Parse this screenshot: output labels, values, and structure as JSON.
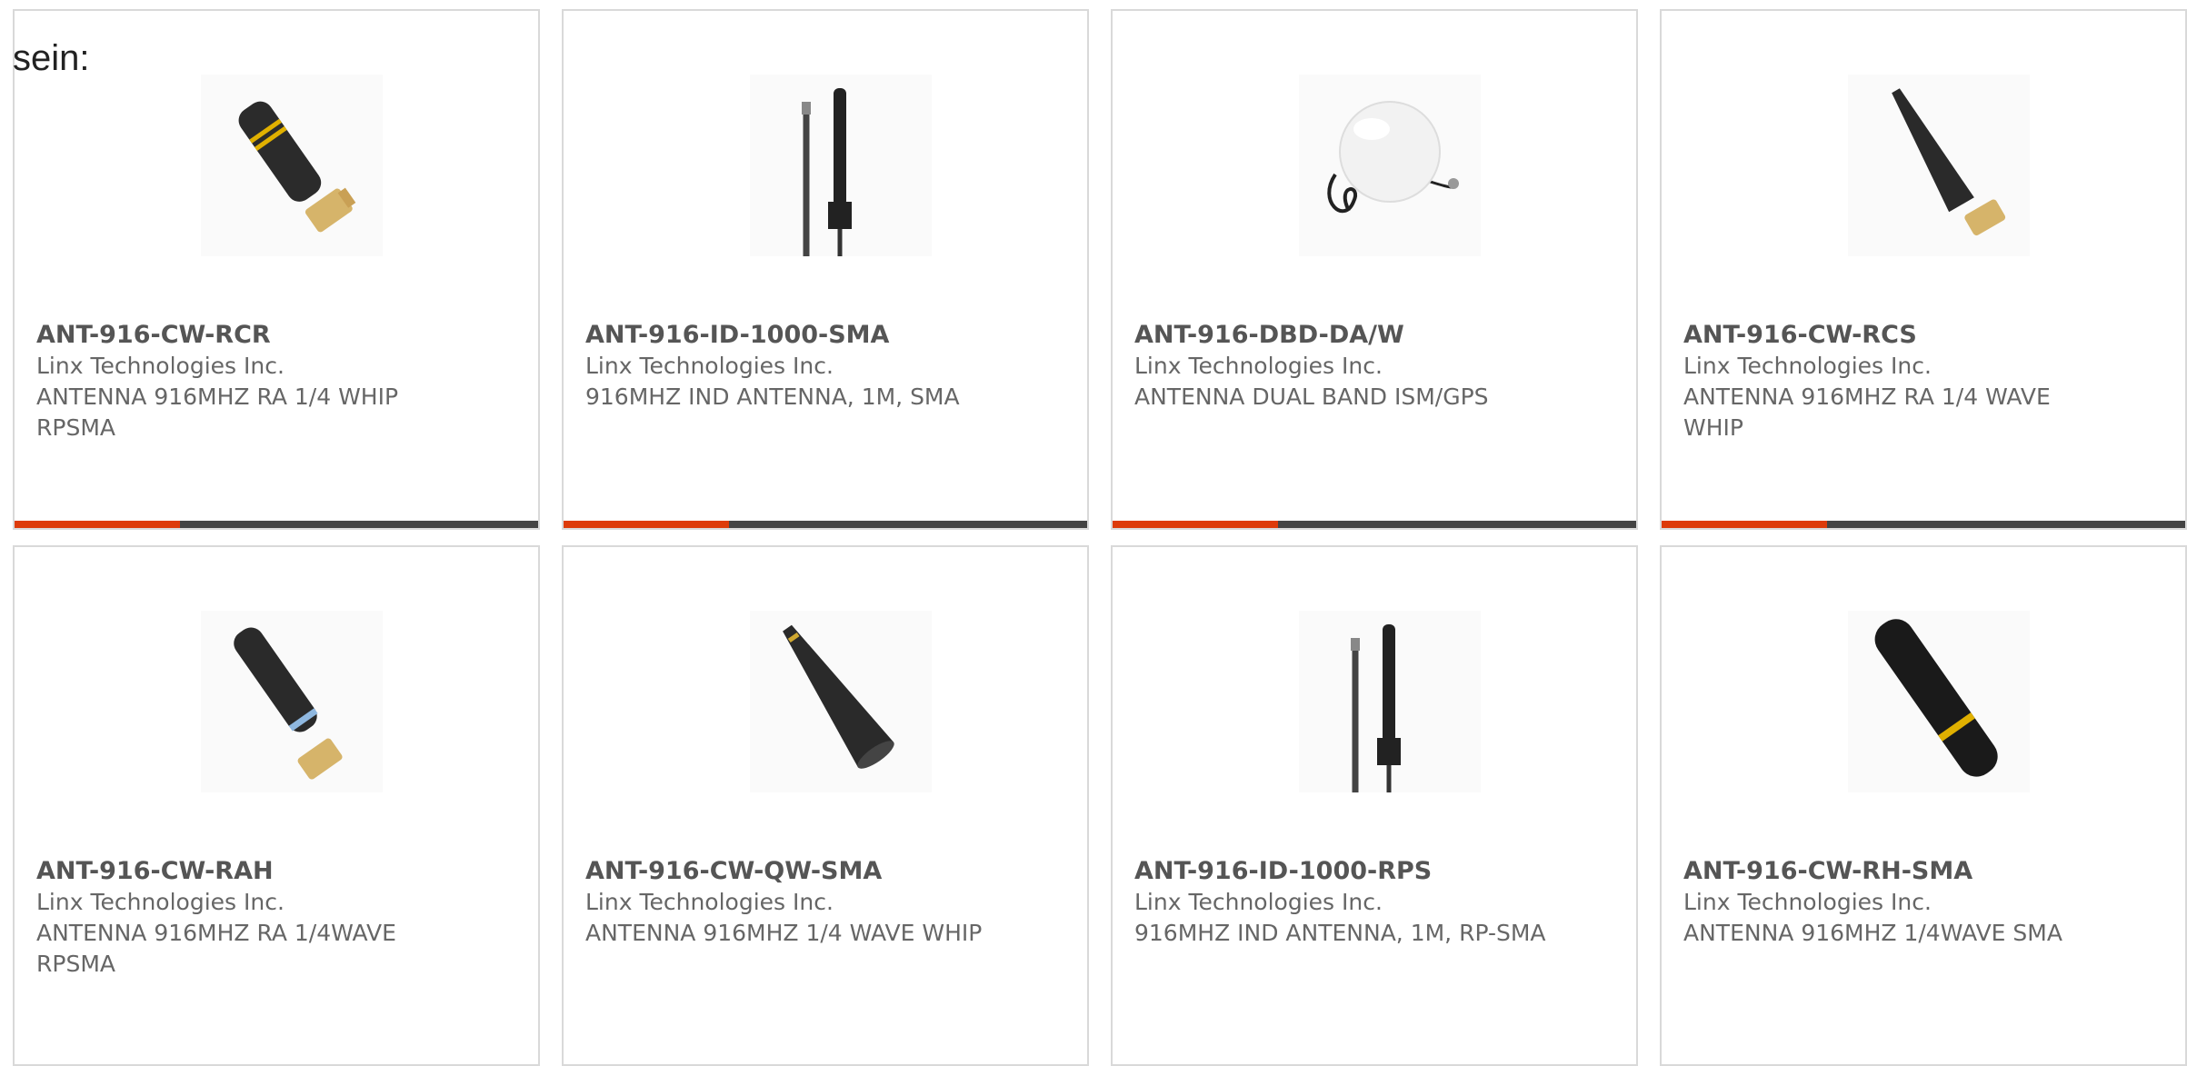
{
  "intro_text": "sein:",
  "colors": {
    "accent": "#dd3b0a",
    "bar": "#444444",
    "border": "#d9d9d9"
  },
  "products": [
    {
      "part_number": "ANT-916-CW-RCR",
      "manufacturer": "Linx Technologies Inc.",
      "description": "ANTENNA 916MHZ RA 1/4 WHIP RPSMA",
      "icon": "stubby-antenna-right-angle-image"
    },
    {
      "part_number": "ANT-916-ID-1000-SMA",
      "manufacturer": "Linx Technologies Inc.",
      "description": "916MHZ IND ANTENNA, 1M, SMA",
      "icon": "mast-antenna-with-cable-image"
    },
    {
      "part_number": "ANT-916-DBD-DA/W",
      "manufacturer": "Linx Technologies Inc.",
      "description": "ANTENNA DUAL BAND ISM/GPS",
      "icon": "dome-antenna-image"
    },
    {
      "part_number": "ANT-916-CW-RCS",
      "manufacturer": "Linx Technologies Inc.",
      "description": "ANTENNA 916MHZ RA 1/4 WAVE WHIP",
      "icon": "whip-antenna-right-angle-image"
    },
    {
      "part_number": "ANT-916-CW-RAH",
      "manufacturer": "Linx Technologies Inc.",
      "description": "ANTENNA 916MHZ RA 1/4WAVE RPSMA",
      "icon": "stubby-antenna-blue-band-image"
    },
    {
      "part_number": "ANT-916-CW-QW-SMA",
      "manufacturer": "Linx Technologies Inc.",
      "description": "ANTENNA 916MHZ 1/4 WAVE WHIP",
      "icon": "tapered-antenna-image"
    },
    {
      "part_number": "ANT-916-ID-1000-RPS",
      "manufacturer": "Linx Technologies Inc.",
      "description": "916MHZ IND ANTENNA, 1M, RP-SMA",
      "icon": "mast-antenna-with-cable-image"
    },
    {
      "part_number": "ANT-916-CW-RH-SMA",
      "manufacturer": "Linx Technologies Inc.",
      "description": "ANTENNA 916MHZ 1/4WAVE SMA",
      "icon": "straight-stubby-antenna-image"
    }
  ]
}
